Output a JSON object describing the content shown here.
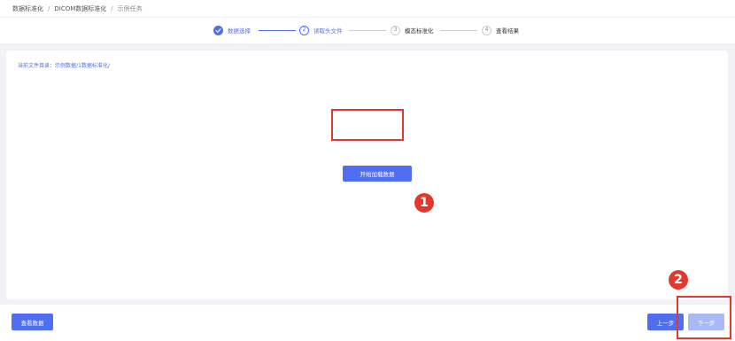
{
  "breadcrumb": {
    "items": [
      "数据标准化",
      "DICOM数据标准化",
      "示例任务"
    ],
    "separator": "/"
  },
  "steps": [
    {
      "number": "✓",
      "label": "数据选择",
      "status": "done"
    },
    {
      "number": "2",
      "label": "读取头文件",
      "status": "active"
    },
    {
      "number": "3",
      "label": "模态标准化",
      "status": "pending"
    },
    {
      "number": "4",
      "label": "查看结果",
      "status": "pending"
    }
  ],
  "main": {
    "directory_text": "当前文件目录：示例数据/1数据标准化/",
    "load_button": "开始加载数据"
  },
  "annotations": {
    "badge_1": "1",
    "badge_2": "2"
  },
  "footer": {
    "view_data_button": "查看数据",
    "prev_button": "上一步",
    "next_button": "下一步"
  },
  "colors": {
    "accent": "#4f6ef2",
    "accent_disabled": "#a9b9f6",
    "highlight": "#e3392c",
    "background": "#f0f2f5"
  }
}
